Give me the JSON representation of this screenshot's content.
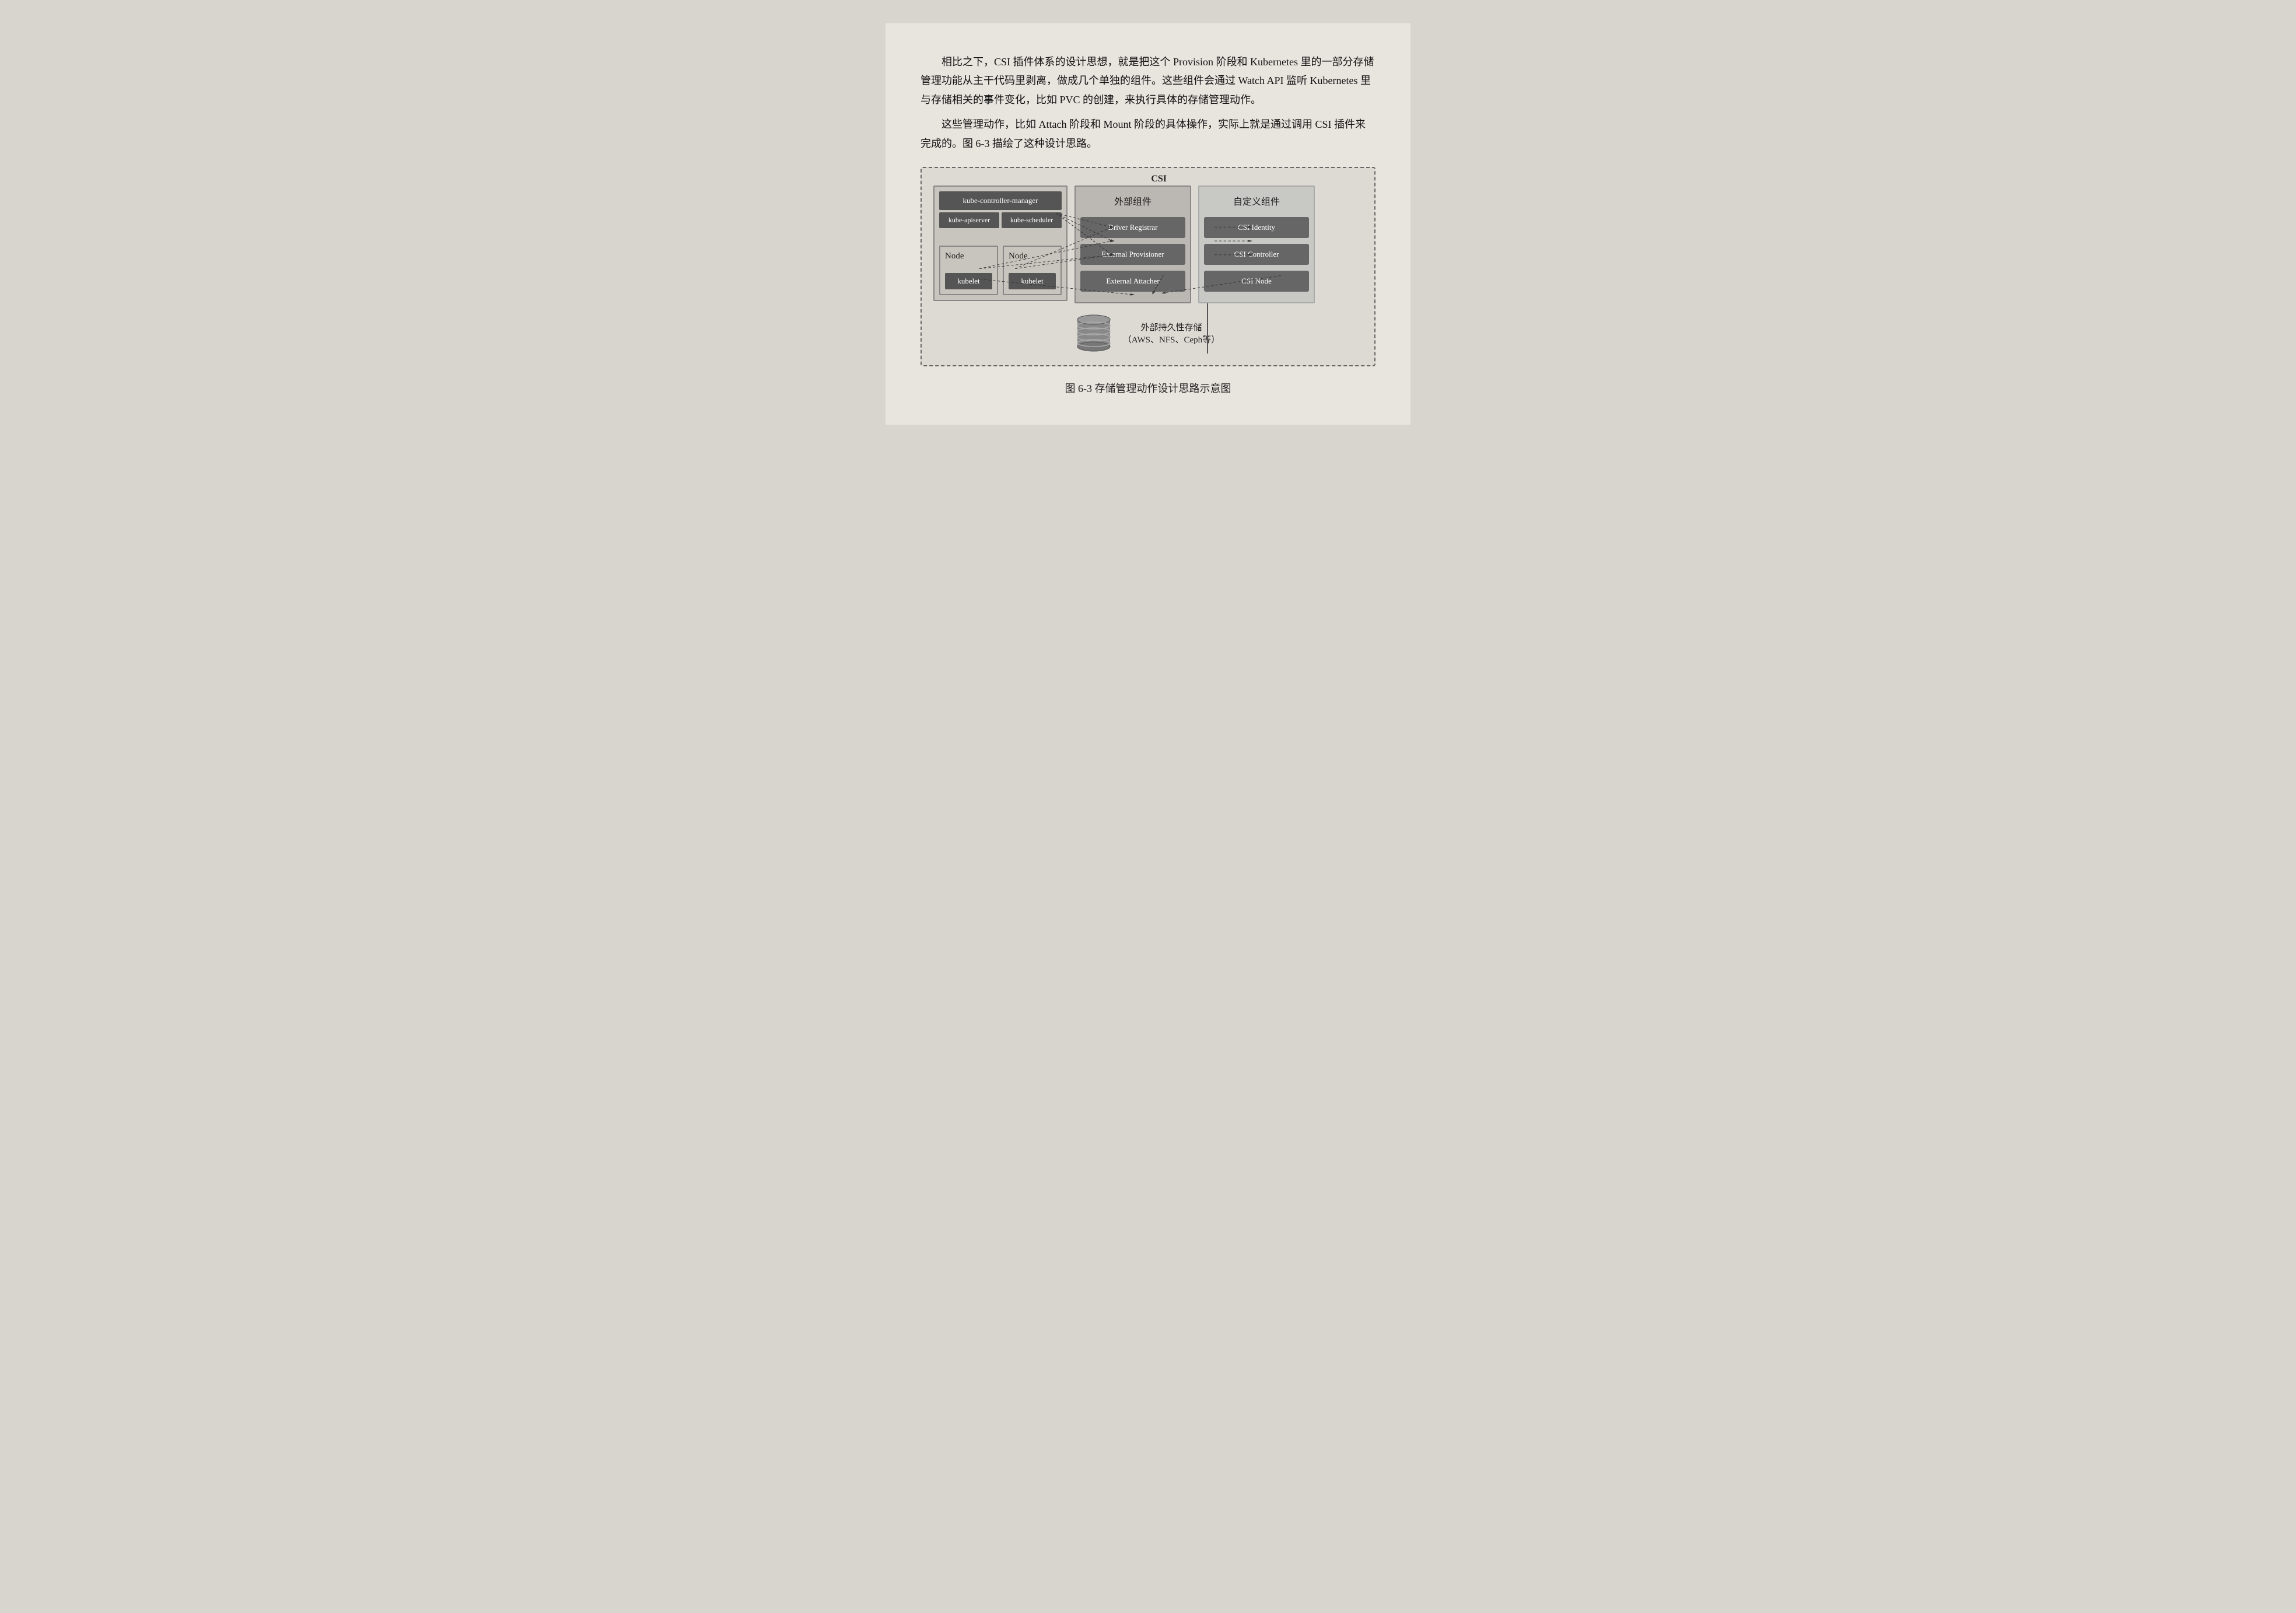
{
  "paragraphs": {
    "p1": "相比之下，CSI 插件体系的设计思想，就是把这个 Provision 阶段和 Kubernetes 里的一部分存储管理功能从主干代码里剥离，做成几个单独的组件。这些组件会通过 Watch API 监听 Kubernetes 里与存储相关的事件变化，比如 PVC 的创建，来执行具体的存储管理动作。",
    "p2": "这些管理动作，比如 Attach 阶段和 Mount 阶段的具体操作，实际上就是通过调用 CSI 插件来完成的。图 6-3 描绘了这种设计思路。"
  },
  "diagram": {
    "csi_label": "CSI",
    "left_panel": {
      "kube_controller_manager": "kube-controller-manager",
      "kube_apiserver": "kube-apiserver",
      "kube_scheduler": "kube-scheduler",
      "node1_label": "Node",
      "node2_label": "Node",
      "kubelet1": "kubelet",
      "kubelet2": "kubelet"
    },
    "middle_panel": {
      "title": "外部组件",
      "components": [
        "Driver Registrar",
        "External Provisioner",
        "External Attacher"
      ]
    },
    "right_panel": {
      "title": "自定义组件",
      "components": [
        "CSI Identity",
        "CSI Controller",
        "CSI Node"
      ]
    },
    "storage": {
      "label_line1": "外部持久性存储",
      "label_line2": "（AWS、NFS、Ceph等）"
    }
  },
  "figure_caption": "图 6-3   存储管理动作设计思路示意图"
}
